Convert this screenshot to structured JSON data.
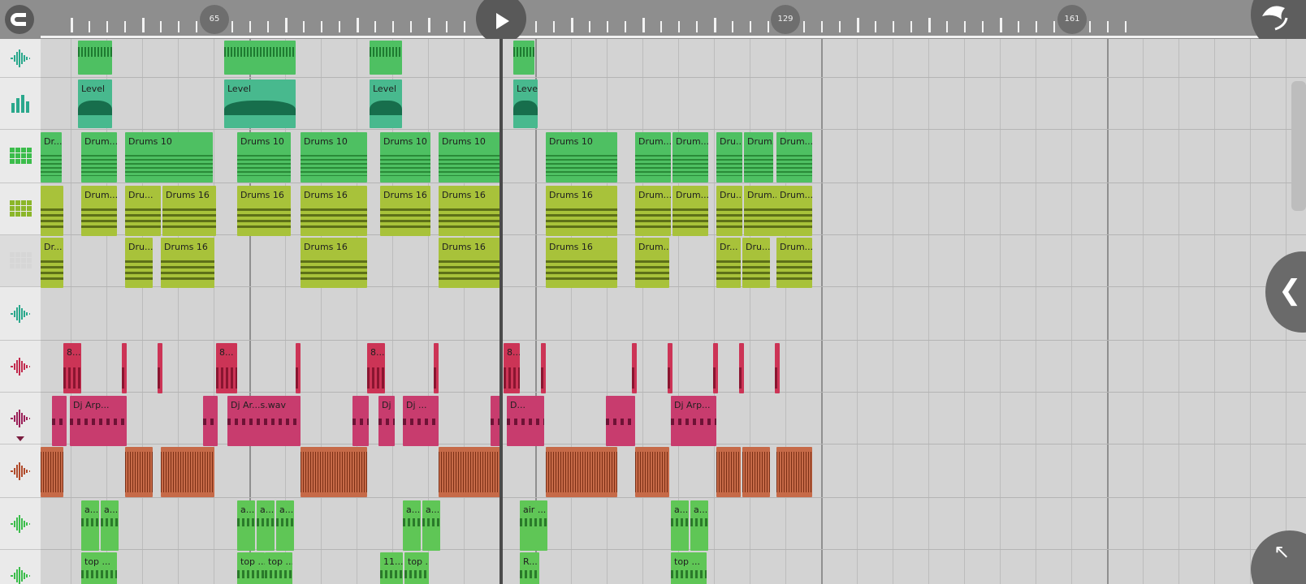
{
  "app": {
    "colors": {
      "topbar": "#8e8e8e",
      "arrange_background": "#d3d3d3",
      "drum_green": "#4ec062",
      "drum_olive": "#a8c23a",
      "level_teal": "#48b98e",
      "sample_red": "#cc3456",
      "arp_magenta": "#c83c6e",
      "loop_brown": "#c66a48"
    }
  },
  "toolbar": {
    "snap_icon": "magnet-snap-icon",
    "play_icon": "play-icon",
    "logo_icon": "app-logo-icon",
    "bar_markers": [
      "65",
      "129",
      "161"
    ]
  },
  "tracks": [
    {
      "icon": "audio-waveform-icon",
      "color": "#2aa88c"
    },
    {
      "icon": "level-automation-icon",
      "color": "#2aa88c"
    },
    {
      "icon": "drum-pads-icon",
      "color": "#3bbd4b"
    },
    {
      "icon": "drum-pads-icon",
      "color": "#8bb62a"
    },
    {
      "icon": "drum-pads-empty-icon",
      "color": "#d6d6d6"
    },
    {
      "icon": "audio-waveform-icon",
      "color": "#2aa88c"
    },
    {
      "icon": "audio-waveform-icon",
      "color": "#c22a4e"
    },
    {
      "icon": "audio-waveform-icon",
      "color": "#9a1f58"
    },
    {
      "icon": "audio-waveform-icon",
      "color": "#b04a2a"
    },
    {
      "icon": "audio-waveform-icon",
      "color": "#3bbd4b"
    },
    {
      "icon": "audio-waveform-icon",
      "color": "#3bbd4b"
    }
  ],
  "clips": {
    "row0_audio": [
      {
        "label": ""
      },
      {
        "label": ""
      },
      {
        "label": ""
      },
      {
        "label": ""
      }
    ],
    "row1_level": [
      {
        "label": "Level"
      },
      {
        "label": "Level"
      },
      {
        "label": "Level"
      },
      {
        "label": "Level"
      }
    ],
    "row2_drums10": [
      {
        "label": "Dr..."
      },
      {
        "label": "Drum..."
      },
      {
        "label": "Drums 10"
      },
      {
        "label": "Drums 10"
      },
      {
        "label": "Drums 10"
      },
      {
        "label": "Drums 10"
      },
      {
        "label": "Drums 10"
      },
      {
        "label": "Drums 10"
      },
      {
        "label": "Drum..."
      },
      {
        "label": "Drum..."
      },
      {
        "label": "Dru..."
      },
      {
        "label": "Drum..."
      },
      {
        "label": "Drum..."
      }
    ],
    "row3_drums16": [
      {
        "label": ""
      },
      {
        "label": "Drum..."
      },
      {
        "label": "Dru..."
      },
      {
        "label": "Drums 16"
      },
      {
        "label": "Drums 16"
      },
      {
        "label": "Drums 16"
      },
      {
        "label": "Drums 16"
      },
      {
        "label": "Drums 16"
      },
      {
        "label": "Drums 16"
      },
      {
        "label": "Drum..."
      },
      {
        "label": "Drum..."
      },
      {
        "label": "Dru..."
      },
      {
        "label": "Drum..."
      },
      {
        "label": "Drum..."
      }
    ],
    "row4_drums16b": [
      {
        "label": "Dr..."
      },
      {
        "label": "Dru..."
      },
      {
        "label": "Drums 16"
      },
      {
        "label": "Drums 16"
      },
      {
        "label": "Drums 16"
      },
      {
        "label": "Drums 16"
      },
      {
        "label": "Drum..."
      },
      {
        "label": "Dr..."
      },
      {
        "label": "Dru..."
      },
      {
        "label": "Drum..."
      }
    ],
    "row6_samples": [
      {
        "label": "8..."
      },
      {
        "label": ""
      },
      {
        "label": ""
      },
      {
        "label": "8..."
      },
      {
        "label": ""
      },
      {
        "label": "8..."
      },
      {
        "label": ""
      },
      {
        "label": "8..."
      },
      {
        "label": ""
      },
      {
        "label": ""
      },
      {
        "label": ""
      },
      {
        "label": ""
      },
      {
        "label": ""
      },
      {
        "label": ""
      }
    ],
    "row7_arp": [
      {
        "label": ""
      },
      {
        "label": "Dj Arp..."
      },
      {
        "label": ""
      },
      {
        "label": "Dj Ar...s.wav"
      },
      {
        "label": ""
      },
      {
        "label": "Dj ..."
      },
      {
        "label": "Dj ..."
      },
      {
        "label": ""
      },
      {
        "label": "D..."
      },
      {
        "label": ""
      },
      {
        "label": "Dj Arp..."
      }
    ],
    "row8_loops": [
      {
        "label": ""
      },
      {
        "label": ""
      },
      {
        "label": ""
      },
      {
        "label": ""
      },
      {
        "label": ""
      },
      {
        "label": ""
      },
      {
        "label": ""
      },
      {
        "label": ""
      },
      {
        "label": ""
      },
      {
        "label": ""
      }
    ],
    "row9_air": [
      {
        "label": "a..."
      },
      {
        "label": "a..."
      },
      {
        "label": "a..."
      },
      {
        "label": "a..."
      },
      {
        "label": "a..."
      },
      {
        "label": "a..."
      },
      {
        "label": "a..."
      },
      {
        "label": "air ..."
      },
      {
        "label": "a..."
      },
      {
        "label": "a..."
      }
    ],
    "row10_top": [
      {
        "label": "top ..."
      },
      {
        "label": "top ..."
      },
      {
        "label": "top ..."
      },
      {
        "label": "11..."
      },
      {
        "label": "top ..."
      },
      {
        "label": "R..."
      },
      {
        "label": "top ..."
      }
    ]
  },
  "right_controls": {
    "side_panel_icon": "chevron-left-icon",
    "side_panel_glyph": "❮",
    "expand_icon": "expand-arrow-icon",
    "expand_glyph": "↖"
  }
}
